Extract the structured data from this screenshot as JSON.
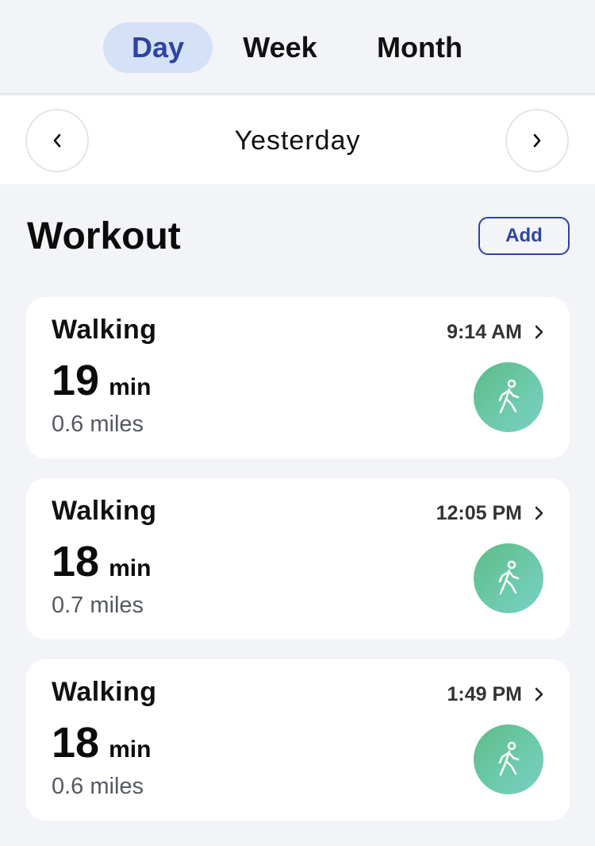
{
  "tabs": [
    {
      "label": "Day",
      "active": true
    },
    {
      "label": "Week",
      "active": false
    },
    {
      "label": "Month",
      "active": false
    }
  ],
  "date_nav": {
    "label": "Yesterday",
    "prev_icon": "chevron-left-icon",
    "next_icon": "chevron-right-icon"
  },
  "section": {
    "title": "Workout",
    "add_label": "Add"
  },
  "workouts": [
    {
      "type": "Walking",
      "duration": "19",
      "unit": "min",
      "distance": "0.6 miles",
      "time": "9:14 AM",
      "icon": "walking-person-icon"
    },
    {
      "type": "Walking",
      "duration": "18",
      "unit": "min",
      "distance": "0.7 miles",
      "time": "12:05 PM",
      "icon": "walking-person-icon"
    },
    {
      "type": "Walking",
      "duration": "18",
      "unit": "min",
      "distance": "0.6 miles",
      "time": "1:49 PM",
      "icon": "walking-person-icon"
    }
  ],
  "colors": {
    "accent": "#2d44a0",
    "active_tab_bg": "#d5e1f7",
    "icon_gradient_start": "#5cbb88",
    "icon_gradient_end": "#7acfc8",
    "background": "#f3f4f8"
  }
}
